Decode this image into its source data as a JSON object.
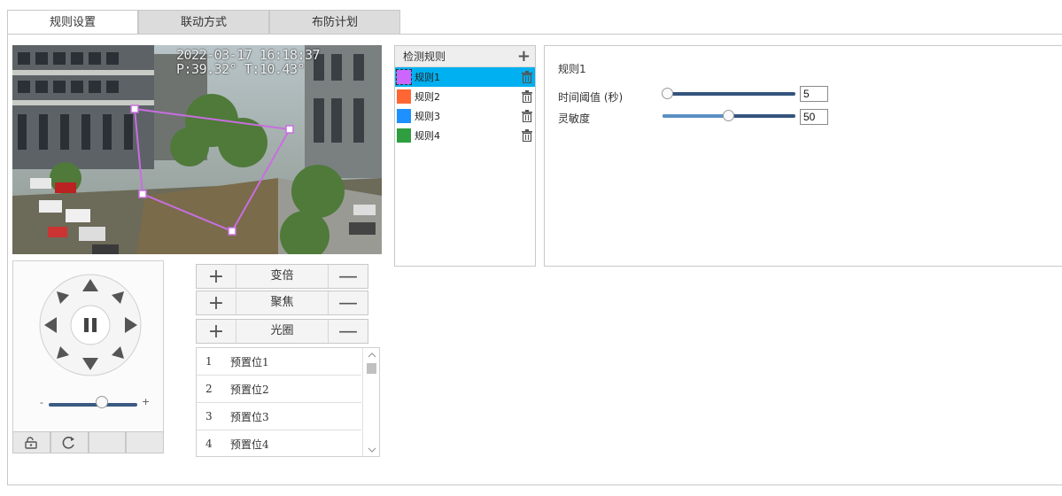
{
  "tabs": [
    {
      "label": "规则设置",
      "active": true
    },
    {
      "label": "联动方式",
      "active": false
    },
    {
      "label": "布防计划",
      "active": false
    }
  ],
  "video": {
    "osd_line1": "2022-03-17 16:18:37",
    "osd_line2": "P:39.32°  T:10.43°",
    "polygon_color": "#c86ee0"
  },
  "ptz": {
    "directions": [
      "up",
      "up-right",
      "right",
      "down-right",
      "down",
      "down-left",
      "left",
      "up-left"
    ],
    "center_icon": "pause-icon",
    "speed_minus": "-",
    "speed_plus": "+",
    "speed_level": 0.6,
    "bottom_icons": [
      "lock-icon",
      "rotate-icon",
      "",
      ""
    ]
  },
  "lens": {
    "rows": [
      {
        "plus": "+",
        "label": "变倍",
        "minus": "—"
      },
      {
        "plus": "+",
        "label": "聚焦",
        "minus": "—"
      },
      {
        "plus": "+",
        "label": "光圈",
        "minus": "—"
      }
    ]
  },
  "presets": [
    {
      "num": "1",
      "name": "预置位1"
    },
    {
      "num": "2",
      "name": "预置位2"
    },
    {
      "num": "3",
      "name": "预置位3"
    },
    {
      "num": "4",
      "name": "预置位4"
    }
  ],
  "rules": {
    "header": "检测规则",
    "add_icon": "plus-icon",
    "items": [
      {
        "name": "规则1",
        "color": "#cc66ff",
        "selected": true
      },
      {
        "name": "规则2",
        "color": "#ff6633",
        "selected": false
      },
      {
        "name": "规则3",
        "color": "#1e90ff",
        "selected": false
      },
      {
        "name": "规则4",
        "color": "#2e9e3e",
        "selected": false
      }
    ]
  },
  "detail": {
    "title": "规则1",
    "time_threshold_label": "时间阈值 (秒)",
    "time_threshold_value": "5",
    "time_threshold_fraction": 0.0,
    "sensitivity_label": "灵敏度",
    "sensitivity_value": "50",
    "sensitivity_fraction": 0.5
  }
}
